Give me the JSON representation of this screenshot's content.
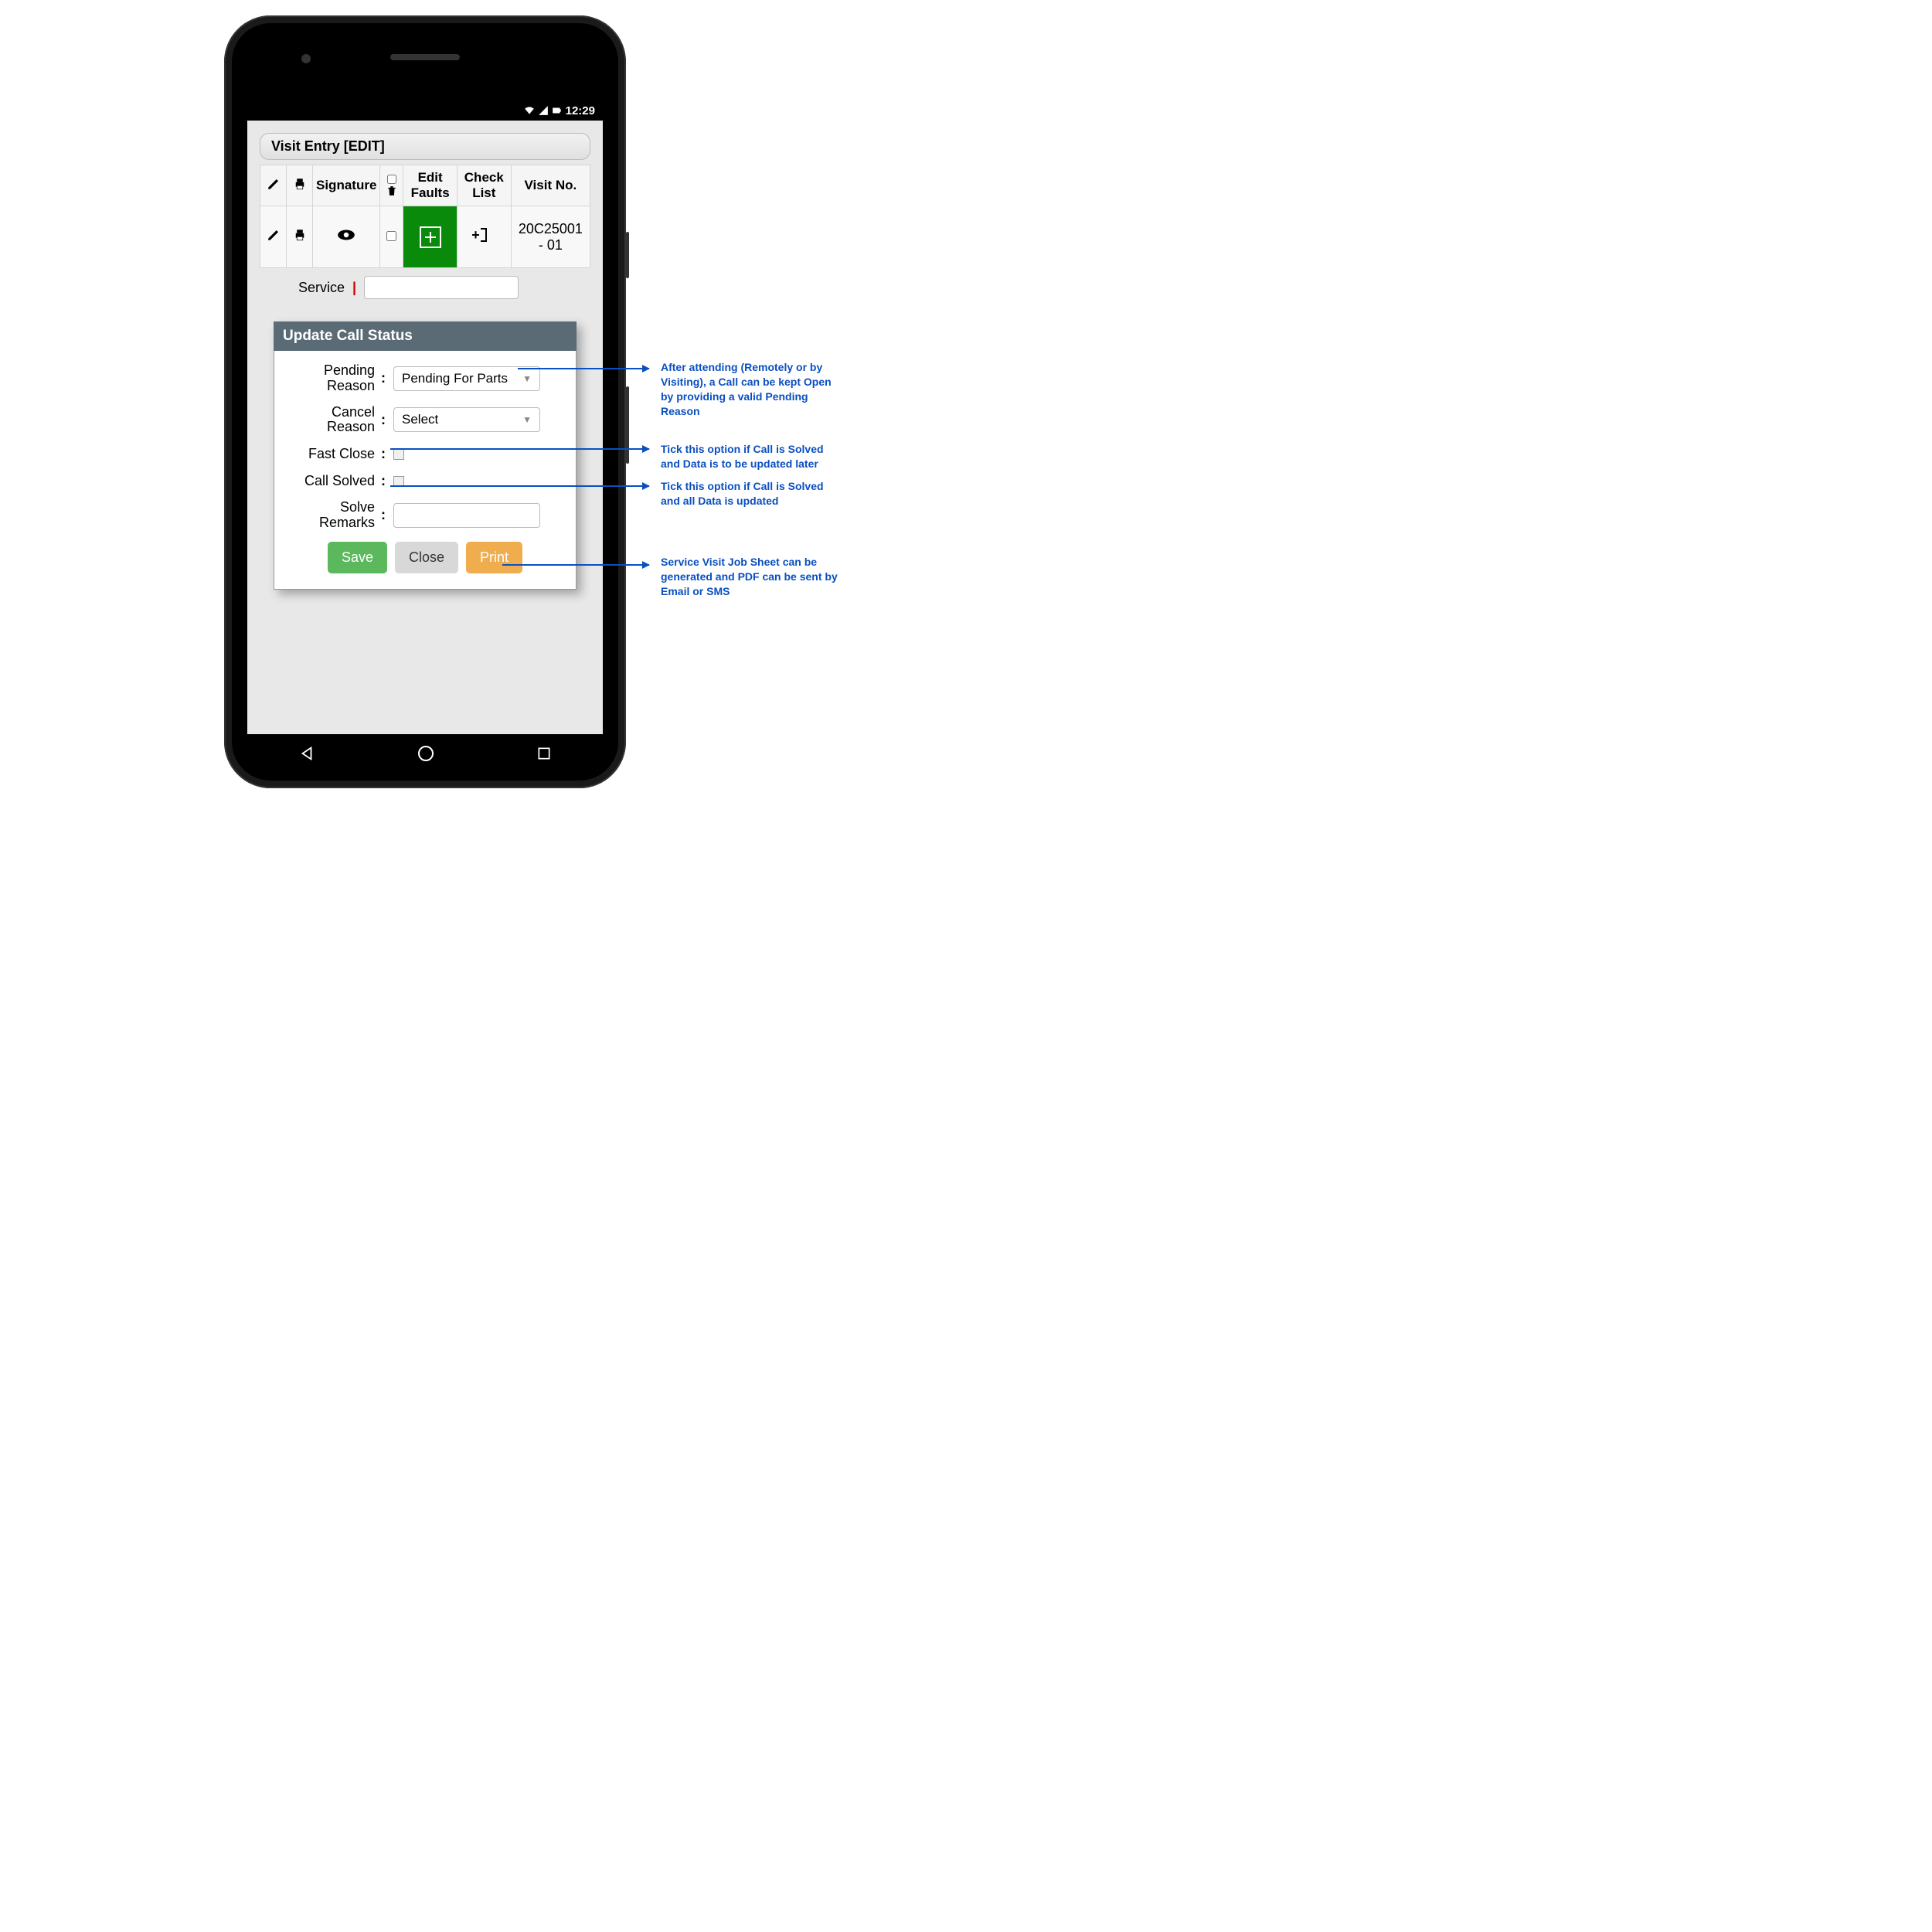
{
  "status_bar": {
    "time": "12:29"
  },
  "page": {
    "title": "Visit Entry [EDIT]",
    "service_label": "Service"
  },
  "table": {
    "headers": {
      "signature": "Signature",
      "edit_faults": "Edit Faults",
      "check_list": "Check List",
      "visit_no": "Visit No."
    },
    "rows": [
      {
        "visit_no": "20C25001 - 01"
      }
    ]
  },
  "dialog": {
    "title": "Update Call Status",
    "fields": {
      "pending_reason": {
        "label": "Pending Reason",
        "value": "Pending For Parts"
      },
      "cancel_reason": {
        "label": "Cancel Reason",
        "value": "Select"
      },
      "fast_close": {
        "label": "Fast Close"
      },
      "call_solved": {
        "label": "Call Solved"
      },
      "solve_remarks": {
        "label": "Solve Remarks",
        "value": ""
      }
    },
    "buttons": {
      "save": "Save",
      "close": "Close",
      "print": "Print"
    }
  },
  "annotations": {
    "pending": "After attending (Remotely or by Visiting), a Call can be kept Open by providing a valid Pending Reason",
    "fast_close": "Tick this option if Call is Solved and Data is to be updated later",
    "call_solved": "Tick this option if Call is Solved and all Data is updated",
    "print": "Service Visit Job Sheet can be generated and PDF can be sent by Email or SMS"
  }
}
